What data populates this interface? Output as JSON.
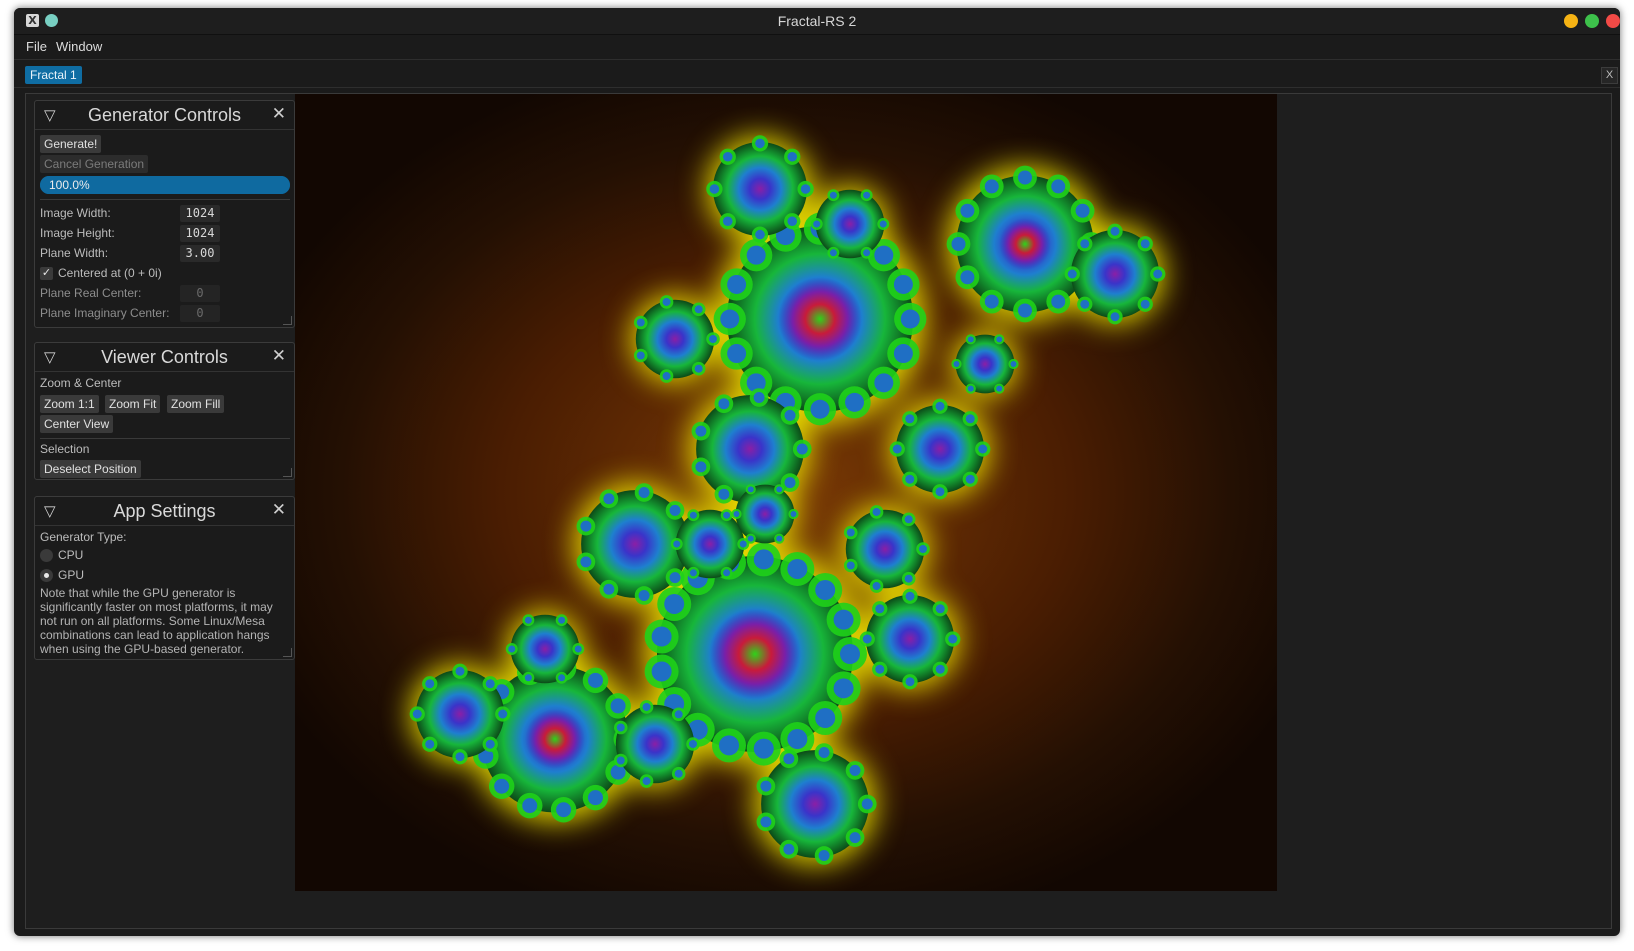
{
  "window": {
    "title": "Fractal-RS 2",
    "app_icon_glyph": "X",
    "controls": [
      "minimize-button",
      "maximize-button",
      "close-button"
    ]
  },
  "menu": [
    "File",
    "Window"
  ],
  "tabs": [
    {
      "label": "Fractal 1",
      "active": true
    }
  ],
  "tab_close_label": "X",
  "generator_controls": {
    "title": "Generator Controls",
    "generate_label": "Generate!",
    "cancel_label": "Cancel Generation",
    "progress": 1.0,
    "progress_text": "100.0%",
    "fields": [
      {
        "label": "Image Width:",
        "value": "1024"
      },
      {
        "label": "Image Height:",
        "value": "1024"
      },
      {
        "label": "Plane Width:",
        "value": "3.00"
      }
    ],
    "centered_checkbox": {
      "label": "Centered at (0 + 0i)",
      "checked": true
    },
    "disabled_fields": [
      {
        "label": "Plane Real Center:",
        "value": "0"
      },
      {
        "label": "Plane Imaginary Center:",
        "value": "0"
      }
    ]
  },
  "viewer_controls": {
    "title": "Viewer Controls",
    "zoom_section": "Zoom & Center",
    "zoom_buttons": [
      "Zoom 1:1",
      "Zoom Fit",
      "Zoom Fill"
    ],
    "center_view_label": "Center View",
    "selection_section": "Selection",
    "deselect_label": "Deselect Position"
  },
  "app_settings": {
    "title": "App Settings",
    "generator_type_label": "Generator Type:",
    "options": [
      {
        "label": "CPU",
        "selected": false
      },
      {
        "label": "GPU",
        "selected": true
      }
    ],
    "note": "Note that while the GPU generator is significantly faster on most platforms, it may not run on all platforms. Some Linux/Mesa combinations can lead to application hangs when using the GPU-based generator."
  },
  "colors": {
    "accent": "#0f6da3",
    "progress": "#0f6aa0",
    "background": "#1b1b1b",
    "minimize": "#f6b314",
    "maximize": "#3dc14b",
    "close": "#f24a46",
    "fractal_outer": "#3b1603",
    "fractal_glow": "#f0e600",
    "fractal_mid": "#1fd21a",
    "fractal_inner": "#1f6fc4",
    "fractal_core": "#8a1fa6"
  }
}
